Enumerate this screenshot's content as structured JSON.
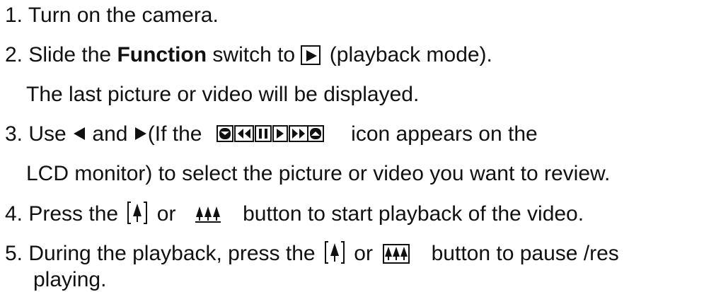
{
  "steps": [
    {
      "text": "1. Turn on the camera."
    },
    {
      "pre": "2. Slide the ",
      "bold": "Function",
      "mid": " switch to ",
      "post": " (playback mode)."
    },
    {
      "text": "The last picture or video will be displayed."
    },
    {
      "pre": "3. Use ",
      "and": " and ",
      "if": "(If the ",
      "post": " icon appears on the"
    },
    {
      "text": "LCD monitor) to select the picture or video you want to review."
    },
    {
      "pre": "4. Press the ",
      "or": " or ",
      "post": " button to start playback of the video."
    },
    {
      "pre": "5. During the playback, press the ",
      "or": " or ",
      "post": " button to pause /res"
    },
    {
      "text": "playing."
    }
  ],
  "icons": {
    "playback_mode": "play-mode-icon",
    "left_arrow": "left-arrow-icon",
    "right_arrow": "right-arrow-icon",
    "control_strip": "playback-controls-icon",
    "tele": "tele-button-icon",
    "wide": "wide-button-icon"
  }
}
